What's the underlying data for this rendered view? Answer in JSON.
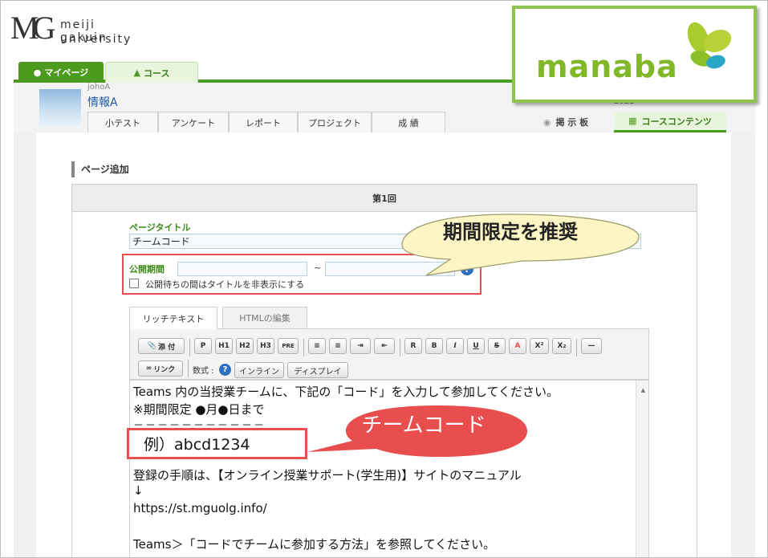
{
  "university": {
    "line1": "meiji gakuin",
    "line2": "university",
    "mark": "MG"
  },
  "main_nav": {
    "mypage": "マイページ",
    "course": "コース"
  },
  "course": {
    "code": "johoA",
    "name": "情報A",
    "year": "2021"
  },
  "course_tabs": [
    "小テスト",
    "アンケート",
    "レポート",
    "プロジェクト",
    "成 績"
  ],
  "right_tabs": {
    "board": "掲 示 板",
    "contents": "コースコンテンツ"
  },
  "manaba": {
    "word": "manaba"
  },
  "page": {
    "heading": "ページ追加",
    "section": "第1回"
  },
  "form": {
    "title_label": "ページタイトル",
    "title_value": "チームコード",
    "period_label": "公開期間",
    "tilde": "~",
    "help": "?",
    "hide_label": "公開待ちの間はタイトルを非表示にする"
  },
  "bubbles": {
    "recommend": "期間限定を推奨",
    "team_code": "チームコード"
  },
  "editor": {
    "tab_rich": "リッチテキスト",
    "tab_html": "HTMLの編集",
    "toolbar": {
      "attach": "添 付",
      "p": "P",
      "h1": "H1",
      "h2": "H2",
      "h3": "H3",
      "pre": "PRE",
      "r": "R",
      "b": "B",
      "i": "I",
      "u": "U",
      "s": "S",
      "a": "A",
      "sup": "X²",
      "sub": "X₂",
      "hr": "—",
      "link": "リンク",
      "formula": "数式 :",
      "inline": "インライン",
      "display": "ディスプレイ"
    },
    "lines": [
      "Teams 内の当授業チームに、下記の「コード」を入力して参加してください。",
      "※期間限定 ●月●日まで",
      "－－－－－－－－－－－",
      "－－－－－－－－－－－",
      "登録の手順は、【オンライン授業サポート(学生用)】サイトのマニュアル",
      "↓",
      "https://st.mguolg.info/",
      "",
      "Teams＞「コードでチームに参加する方法」を参照してください。"
    ],
    "code_example": "例）abcd1234"
  },
  "colors": {
    "green": "#4c9a1e",
    "red_frame": "#e8504f",
    "manaba_green": "#80b82a",
    "bubble_yellow": "#fdf6c4"
  }
}
